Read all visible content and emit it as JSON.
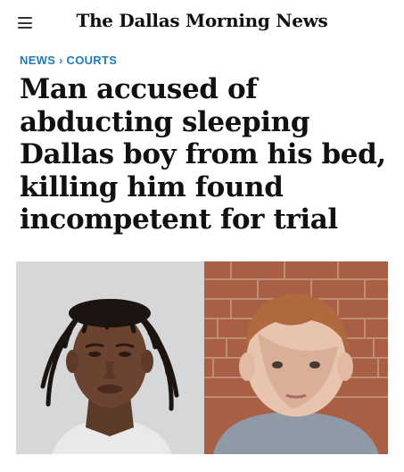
{
  "header": {
    "menu_icon": "hamburger-menu-icon",
    "masthead": "The Dallas Morning News"
  },
  "breadcrumb": {
    "section": "NEWS",
    "separator": "›",
    "subsection": "COURTS"
  },
  "article": {
    "headline": "Man accused of abducting sleeping Dallas boy from his bed, killing him found incompetent for trial"
  },
  "colors": {
    "breadcrumb": "#1e7abf",
    "text": "#111111",
    "background": "#ffffff"
  }
}
